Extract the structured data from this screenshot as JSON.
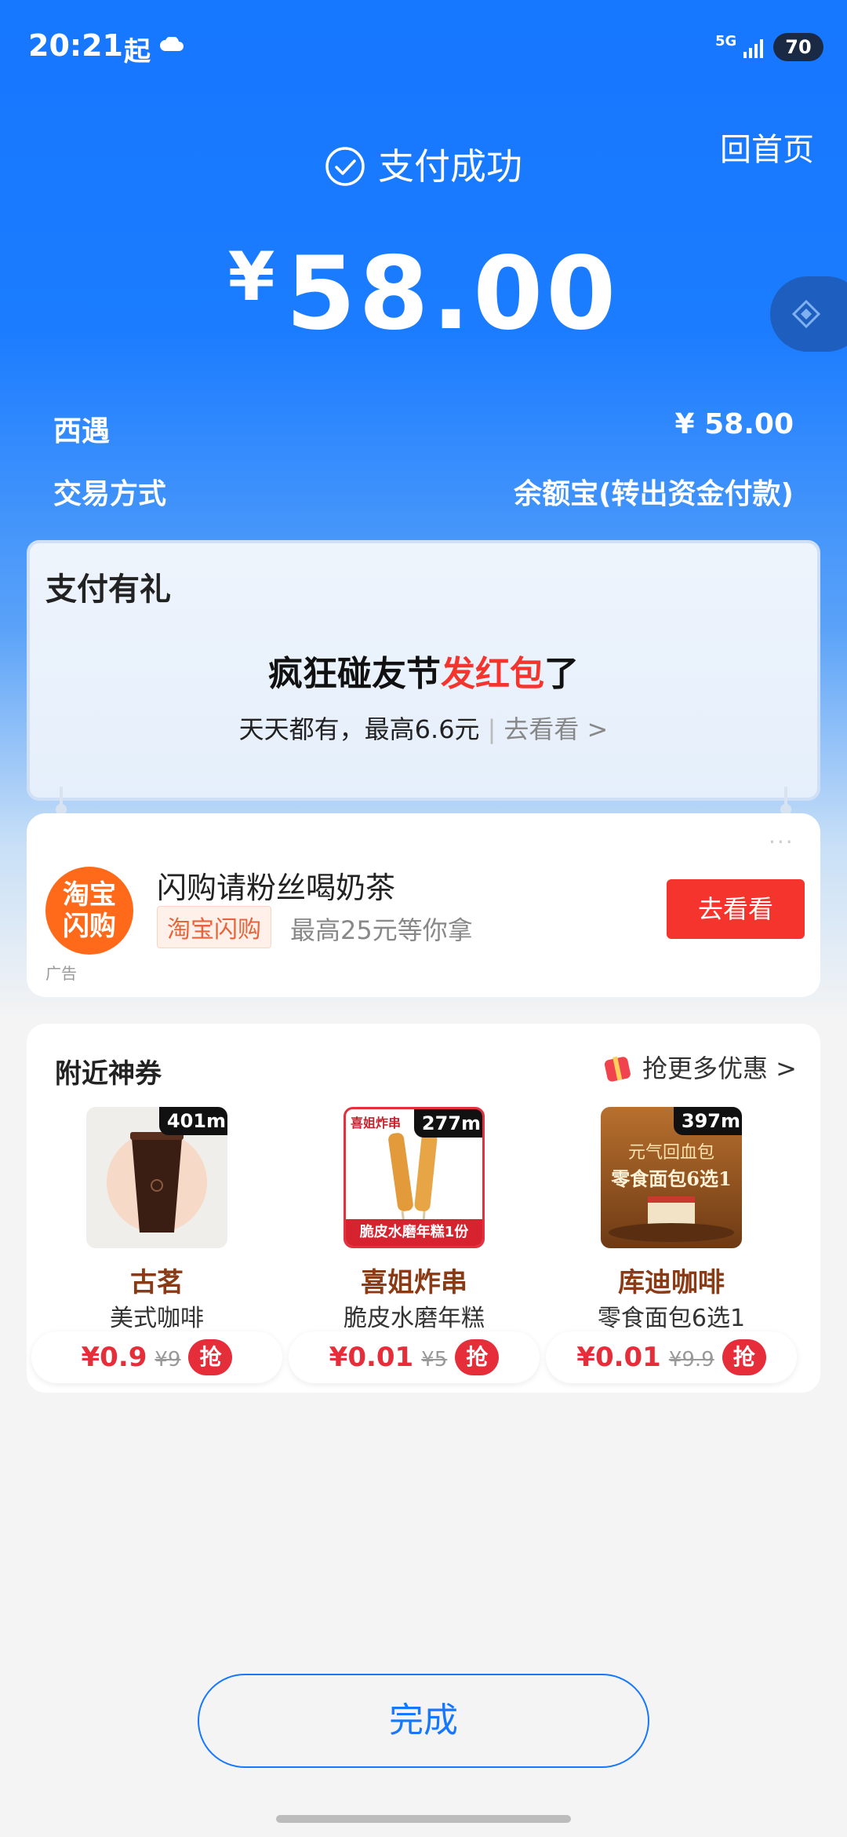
{
  "status": {
    "time": "20:21",
    "notify": "起",
    "network": "5G",
    "battery": "70"
  },
  "header": {
    "home_link": "回首页",
    "result": "支付成功",
    "currency": "¥",
    "amount": "58.00"
  },
  "details": [
    {
      "label": "西遇",
      "value": "¥ 58.00"
    },
    {
      "label": "交易方式",
      "value": "余额宝(转出资金付款)"
    }
  ],
  "gift": {
    "title": "支付有礼",
    "headline_pre": "疯狂碰友节",
    "headline_red": "发红包",
    "headline_post": "了",
    "sub": "天天都有，最高6.6元",
    "sep": "|",
    "link": "去看看 >"
  },
  "ad": {
    "logo_line1": "淘宝",
    "logo_line2": "闪购",
    "title": "闪购请粉丝喝奶茶",
    "tag": "淘宝闪购",
    "desc": "最高25元等你拿",
    "button": "去看看",
    "label": "广告",
    "more": "···"
  },
  "coupons": {
    "title": "附近神券",
    "more": "抢更多优惠 >",
    "items": [
      {
        "distance": "401m",
        "shop": "古茗",
        "product": "美式咖啡",
        "price": "¥0.9",
        "original": "¥9",
        "grab": "抢"
      },
      {
        "distance": "277m",
        "shop": "喜姐炸串",
        "product": "脆皮水磨年糕",
        "price": "¥0.01",
        "original": "¥5",
        "grab": "抢",
        "img_top": "喜姐炸串",
        "img_bottom": "脆皮水磨年糕1份"
      },
      {
        "distance": "397m",
        "shop": "库迪咖啡",
        "product": "零食面包6选1",
        "price": "¥0.01",
        "original": "¥9.9",
        "grab": "抢",
        "img_line1": "元气回血包",
        "img_line2": "零食面包6选1"
      }
    ]
  },
  "footer": {
    "done": "完成"
  },
  "colors": {
    "primary": "#1677ff",
    "red": "#f5352d",
    "coupon_red": "#e62d3a"
  },
  "icons": [
    "check-circle-icon",
    "cloud-icon",
    "signal-icon",
    "diamond-icon",
    "gift-icon",
    "chevron-right-icon"
  ]
}
